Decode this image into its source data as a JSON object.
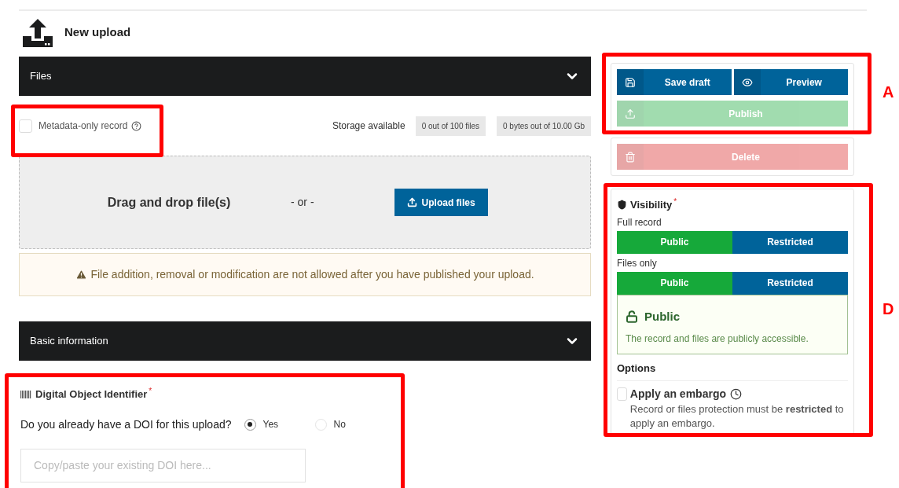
{
  "page_title": "New upload",
  "files_section": {
    "title": "Files",
    "expanded": true,
    "metadata_only": {
      "label": "Metadata-only record",
      "checked": false
    },
    "storage": {
      "label": "Storage available",
      "files": "0 out of 100 files",
      "bytes": "0 bytes out of 10.00 Gb"
    },
    "dropzone": {
      "text": "Drag and drop file(s)",
      "or": "- or -",
      "button": "Upload files"
    },
    "warning": "File addition, removal or modification are not allowed after you have published your upload."
  },
  "basic_section": {
    "title": "Basic information",
    "expanded": true
  },
  "doi": {
    "title": "Digital Object Identifier",
    "required_mark": "*",
    "question": "Do you already have a DOI for this upload?",
    "options": [
      {
        "label": "Yes",
        "selected": true
      },
      {
        "label": "No",
        "selected": false
      }
    ],
    "placeholder": "Copy/paste your existing DOI here..."
  },
  "actions": {
    "save": {
      "label": "Save draft",
      "disabled": false
    },
    "preview": {
      "label": "Preview",
      "disabled": false
    },
    "publish": {
      "label": "Publish",
      "disabled": true
    },
    "delete": {
      "label": "Delete",
      "disabled": true
    }
  },
  "visibility": {
    "title": "Visibility",
    "required_mark": "*",
    "groups": [
      {
        "label": "Full record",
        "options": [
          {
            "label": "Public",
            "selected": true
          },
          {
            "label": "Restricted",
            "selected": false
          }
        ]
      },
      {
        "label": "Files only",
        "options": [
          {
            "label": "Public",
            "selected": true
          },
          {
            "label": "Restricted",
            "selected": false
          }
        ]
      }
    ],
    "status": {
      "title": "Public",
      "text": "The record and files are publicly accessible."
    },
    "options_title": "Options",
    "embargo": {
      "label": "Apply an embargo",
      "checked": false,
      "note": "Record or files protection must be **restricted** to apply an embargo."
    }
  },
  "annotations": [
    {
      "label": "A"
    },
    {
      "label": "D"
    }
  ]
}
